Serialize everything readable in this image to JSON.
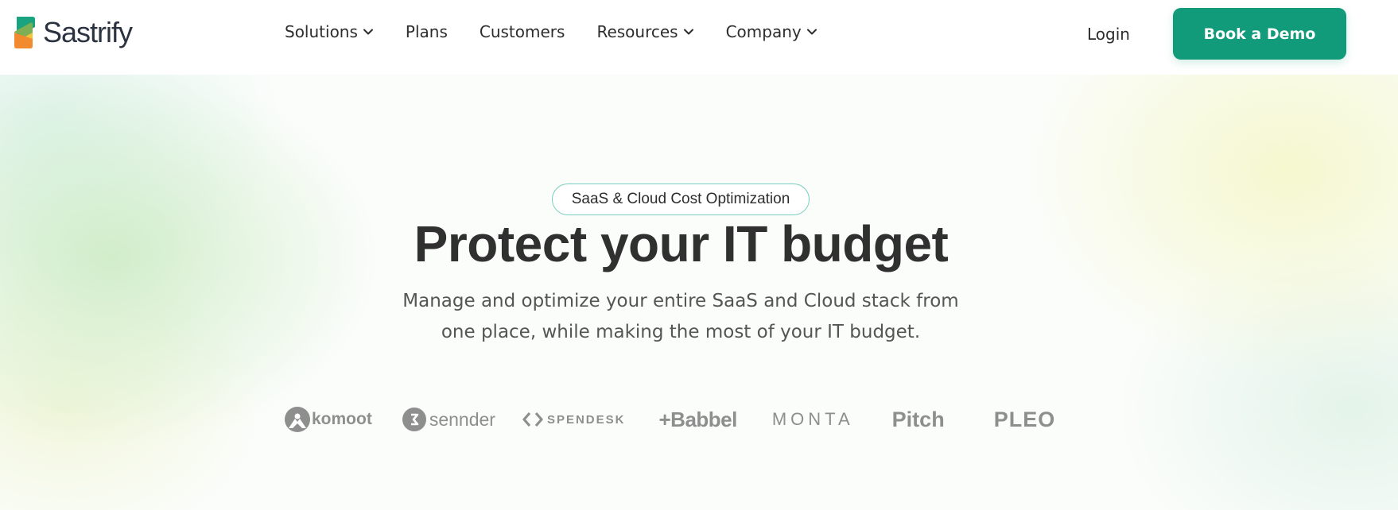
{
  "header": {
    "logo_text": "Sastrify",
    "nav": [
      {
        "label": "Solutions"
      },
      {
        "label": "Plans"
      },
      {
        "label": "Customers"
      },
      {
        "label": "Resources"
      },
      {
        "label": "Company"
      }
    ],
    "login_label": "Login",
    "cta_label": "Book a Demo"
  },
  "hero": {
    "badge": "SaaS & Cloud Cost Optimization",
    "title": "Protect your IT budget",
    "subtitle_line1": "Manage and optimize your entire SaaS and Cloud stack from",
    "subtitle_line2": "one place, while making the most of your IT budget."
  },
  "client_logos": [
    {
      "text": "komoot",
      "icon": "komoot-icon"
    },
    {
      "text": "sennder",
      "icon": "sennder-icon"
    },
    {
      "text": "SPENDESK",
      "icon": "spendesk-icon"
    },
    {
      "text": "+Babbel"
    },
    {
      "text": "MONTA"
    },
    {
      "text": "Pitch"
    },
    {
      "text": "PLEO"
    }
  ],
  "colors": {
    "brand_green": "#129b7a",
    "logo_orange": "#f28a30",
    "logo_yellow": "#f4c43a",
    "logo_green": "#1aa37f",
    "text_dark": "#303030",
    "text_muted": "#555555",
    "client_logo_gray": "#8e8e8e",
    "badge_border": "#7ccdbf"
  }
}
